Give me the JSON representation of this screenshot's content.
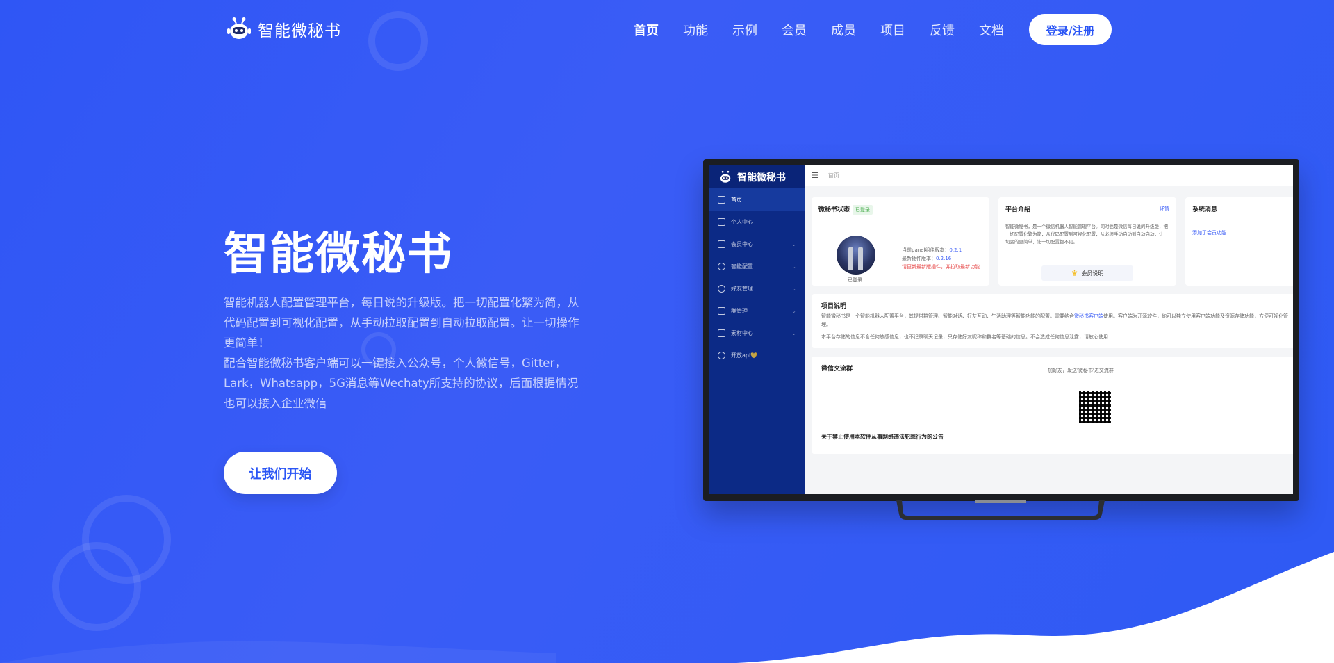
{
  "brand": {
    "name": "智能微秘书"
  },
  "nav": {
    "items": [
      "首页",
      "功能",
      "示例",
      "会员",
      "成员",
      "项目",
      "反馈",
      "文档"
    ],
    "login_label": "登录/注册"
  },
  "hero": {
    "title": "智能微秘书",
    "desc_line1": "智能机器人配置管理平台，每日说的升级版。把一切配置化繁为简，从代码配置到可视化配置，从手动拉取配置到自动拉取配置。让一切操作更简单！",
    "desc_line2": "配合智能微秘书客户端可以一键接入公众号，个人微信号，Gitter，Lark，Whatsapp，5G消息等Wechaty所支持的协议，后面根据情况也可以接入企业微信",
    "cta_label": "让我们开始"
  },
  "screen": {
    "brand": "智能微秘书",
    "sidebar": [
      "首页",
      "个人中心",
      "会员中心",
      "智能配置",
      "好友管理",
      "群管理",
      "素材中心",
      "开放api💛"
    ],
    "breadcrumb": "首页",
    "status_card": {
      "title": "微秘书状态",
      "tag": "已登录",
      "login_state": "已登录",
      "current_version_label": "当前panel组件版本：",
      "current_version": "0.2.1",
      "latest_version_label": "最新插件版本：",
      "latest_version": "0.2.16",
      "update_notice": "请更新最新版插件，并拉取最新功能"
    },
    "intro_card": {
      "title": "平台介绍",
      "detail_link": "详情",
      "text": "智能微秘书，是一个微信机器人智能管理平台。同时也是微信每日说的升级版，把一切配置化繁为简，从代码配置到可视化配置，从必须手动启动到自动启动，让一切变的更简单，让一切配置都不见。",
      "member_btn": "会员说明"
    },
    "system_card": {
      "title": "系统消息",
      "message": "添加了会员功能"
    },
    "project_card": {
      "title": "项目说明",
      "text1_a": "智能微秘书是一个智能机器人配置平台，其提供群管理、智能对话、好友互动、生活助理等智能功能的配置。需要结合",
      "text1_link": "微秘书客户端",
      "text1_b": "使用。客户端为开源软件，你可以独立使用客户端功能及资源存储功能，方便可视化管理。",
      "text2": "本平台存储的信息不含任何敏感信息，也不记录聊天记录，只存储好友昵称和群名等基础的信息。不会造成任何信息泄露，请放心使用"
    },
    "group_card": {
      "title": "微信交流群",
      "subtitle": "加好友，发送'微秘书'进交流群",
      "notice": "关于禁止使用本软件从事网络违法犯罪行为的公告"
    }
  },
  "colors": {
    "background": "#2f56f5",
    "accent": "#2a55f5",
    "sidebar": "#0c2a86"
  }
}
